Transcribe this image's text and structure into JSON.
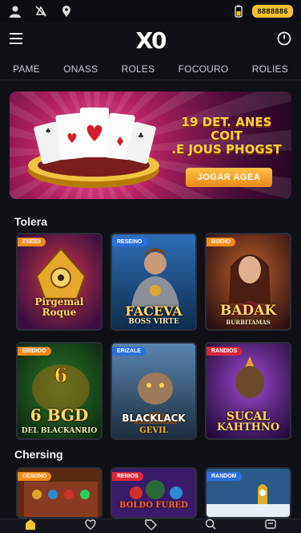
{
  "status": {
    "chip": "8888886"
  },
  "app": {
    "logo": "X0"
  },
  "tabs": [
    "PAME",
    "ONASS",
    "ROLES",
    "FOCOURO",
    "ROLIES"
  ],
  "banner": {
    "headline_line1": "19 DET. ANES COIT",
    "headline_line2": ".E JOUS PHOGST",
    "cta": "JOGAR AGEA"
  },
  "sections": [
    {
      "title": "Tolera",
      "cards": [
        {
          "badge": "ESEIDI",
          "badge_color": "#f08a1a",
          "title": "Pirgemal Roque",
          "sub": ""
        },
        {
          "badge": "RESEINO",
          "badge_color": "#2a6fe0",
          "title": "FACEVA",
          "sub": "BOSS VIRTE"
        },
        {
          "badge": "BSIDIO",
          "badge_color": "#f08a1a",
          "title": "BADAK",
          "sub": "BURBITAMAS"
        }
      ]
    },
    {
      "title": "",
      "cards": [
        {
          "badge": "ERIDIOO",
          "badge_color": "#f08a1a",
          "title": "6 BGD",
          "sub": "DEL BLACKANRIO"
        },
        {
          "badge": "ERIZALE",
          "badge_color": "#2a6fe0",
          "title": "BLACKLACK",
          "sub": "GEVIL"
        },
        {
          "badge": "RANDIOS",
          "badge_color": "#d8283a",
          "title": "SUCAL",
          "sub": "KAHTHNO"
        }
      ]
    },
    {
      "title": "Chersing",
      "cards": [
        {
          "badge": "CESONO",
          "badge_color": "#f08a1a",
          "title": "",
          "sub": ""
        },
        {
          "badge": "RENIOS",
          "badge_color": "#d8283a",
          "title": "BOLDO FURED",
          "sub": ""
        },
        {
          "badge": "RANDOM",
          "badge_color": "#2a6fe0",
          "title": "",
          "sub": ""
        }
      ]
    }
  ],
  "colors": {
    "accent": "#f2c230",
    "background": "#0f1117"
  }
}
